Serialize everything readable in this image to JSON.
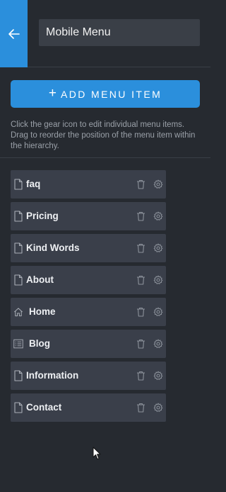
{
  "header": {
    "title_value": "Mobile Menu",
    "back_icon": "arrow-left-icon"
  },
  "actions": {
    "add_plus": "+",
    "add_label": "ADD MENU ITEM"
  },
  "help_text": "Click the gear icon to edit individual menu items. Drag to reorder the position of the menu item within the hierarchy.",
  "menu_items": [
    {
      "label": "faq",
      "icon": "page-icon"
    },
    {
      "label": "Pricing",
      "icon": "page-icon"
    },
    {
      "label": "Kind Words",
      "icon": "page-icon"
    },
    {
      "label": "About",
      "icon": "page-icon"
    },
    {
      "label": "Home",
      "icon": "home-icon"
    },
    {
      "label": "Blog",
      "icon": "blog-list-icon"
    },
    {
      "label": "Information",
      "icon": "page-icon"
    },
    {
      "label": "Contact",
      "icon": "page-icon"
    }
  ],
  "colors": {
    "accent": "#2b8fdc",
    "background": "#262a30",
    "item_bg": "#3a3f4a",
    "muted_text": "#9aa0a8"
  }
}
